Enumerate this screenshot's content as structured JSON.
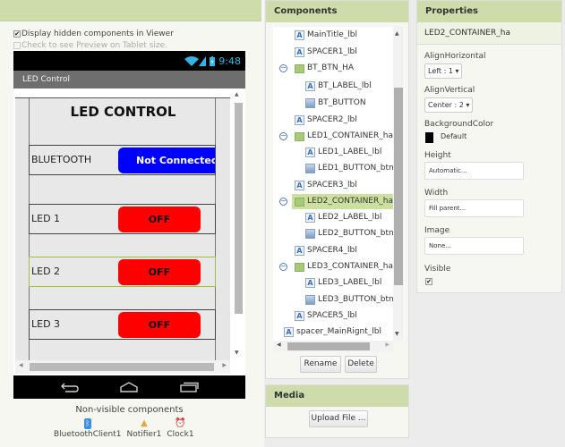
{
  "viewer": {
    "display_hidden_label": "Display hidden components in Viewer",
    "display_hidden_checked": true,
    "tablet_preview_label": "Check to see Preview on Tablet size.",
    "tablet_preview_checked": false,
    "phone": {
      "time": "9:48",
      "app_title": "LED Control",
      "screen_title": "LED CONTROL",
      "rows": [
        {
          "label": "BLUETOOTH",
          "button": "Not Connected",
          "button_color": "#0000ff"
        },
        {
          "label": "LED 1",
          "button": "OFF",
          "button_color": "#ff0000"
        },
        {
          "label": "LED 2",
          "button": "OFF",
          "button_color": "#ff0000",
          "selected": true
        },
        {
          "label": "LED 3",
          "button": "OFF",
          "button_color": "#ff0000"
        }
      ]
    },
    "non_visible_title": "Non-visible components",
    "non_visible": [
      {
        "name": "BluetoothClient1",
        "icon": "bluetooth-icon"
      },
      {
        "name": "Notifier1",
        "icon": "warning-icon"
      },
      {
        "name": "Clock1",
        "icon": "clock-icon"
      }
    ]
  },
  "components": {
    "title": "Components",
    "items": [
      {
        "name": "MainTitle_lbl",
        "type": "label"
      },
      {
        "name": "SPACER1_lbl",
        "type": "label"
      },
      {
        "name": "BT_BTN_HA",
        "type": "arrangement"
      },
      {
        "name": "BT_LABEL_lbl",
        "type": "label"
      },
      {
        "name": "BT_BUTTON",
        "type": "button"
      },
      {
        "name": "SPACER2_lbl",
        "type": "label"
      },
      {
        "name": "LED1_CONTAINER_ha",
        "type": "arrangement"
      },
      {
        "name": "LED1_LABEL_lbl",
        "type": "label"
      },
      {
        "name": "LED1_BUTTON_btn",
        "type": "button"
      },
      {
        "name": "SPACER3_lbl",
        "type": "label"
      },
      {
        "name": "LED2_CONTAINER_ha",
        "type": "arrangement",
        "selected": true
      },
      {
        "name": "LED2_LABEL_lbl",
        "type": "label"
      },
      {
        "name": "LED2_BUTTON_btn",
        "type": "button"
      },
      {
        "name": "SPACER4_lbl",
        "type": "label"
      },
      {
        "name": "LED3_CONTAINER_ha",
        "type": "arrangement"
      },
      {
        "name": "LED3_LABEL_lbl",
        "type": "label"
      },
      {
        "name": "LED3_BUTTON_btn",
        "type": "button"
      },
      {
        "name": "SPACER5_lbl",
        "type": "label"
      },
      {
        "name": "spacer_MainRignt_lbl",
        "type": "label"
      }
    ],
    "rename_label": "Rename",
    "delete_label": "Delete"
  },
  "media": {
    "title": "Media",
    "upload_label": "Upload File ..."
  },
  "properties": {
    "title": "Properties",
    "component": "LED2_CONTAINER_ha",
    "align_horizontal_label": "AlignHorizontal",
    "align_horizontal_value": "Left : 1 ▾",
    "align_vertical_label": "AlignVertical",
    "align_vertical_value": "Center : 2 ▾",
    "background_color_label": "BackgroundColor",
    "background_color_value": "Default",
    "background_color_swatch": "#000000",
    "height_label": "Height",
    "height_value": "Automatic...",
    "width_label": "Width",
    "width_value": "Fill parent...",
    "image_label": "Image",
    "image_value": "None...",
    "visible_label": "Visible",
    "visible_checked": true
  }
}
